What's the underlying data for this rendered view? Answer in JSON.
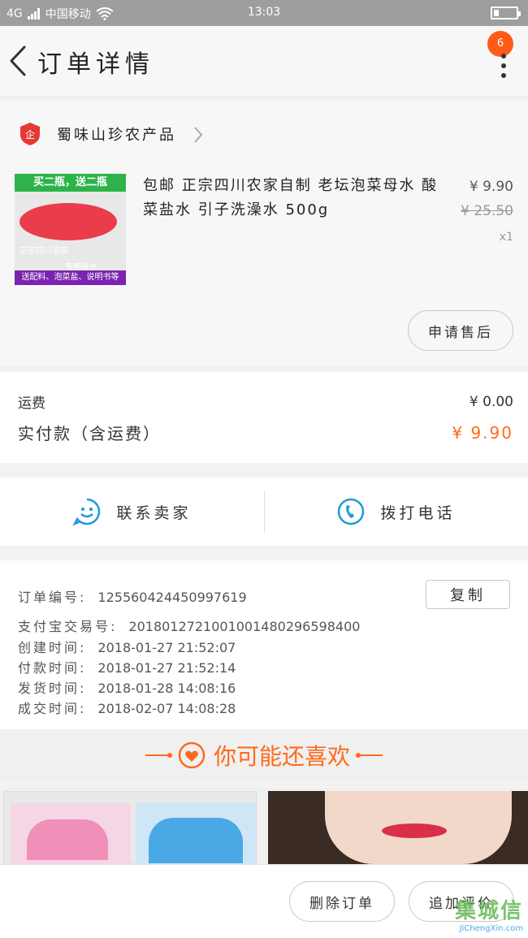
{
  "status_bar": {
    "signal": "4G",
    "carrier": "中国移动",
    "time": "13:03"
  },
  "header": {
    "title": "订单详情",
    "badge": "6"
  },
  "shop": {
    "name": "蜀味山珍农产品"
  },
  "item": {
    "image_top_text": "买二瓶，送二瓶",
    "image_caption": "正宗四川泡菜",
    "image_caption2": "专用母水",
    "image_bottom_text": "送配料、泡菜盐、说明书等",
    "title": "包邮 正宗四川农家自制 老坛泡菜母水 酸菜盐水 引子洗澡水 500g",
    "price": "¥ 9.90",
    "original_price": "¥ 25.50",
    "quantity": "x1",
    "after_sale_label": "申请售后"
  },
  "costs": {
    "shipping_label": "运费",
    "shipping_value": "¥ 0.00",
    "paid_label": "实付款（含运费）",
    "paid_value": "¥ 9.90"
  },
  "contact": {
    "seller_label": "联系卖家",
    "phone_label": "拨打电话"
  },
  "order_info": {
    "copy_label": "复制",
    "order_no_label": "订单编号:",
    "order_no": "125560424450997619",
    "alipay_label": "支付宝交易号:",
    "alipay_no": "2018012721001001480296598400",
    "created_label": "创建时间:",
    "created": "2018-01-27  21:52:07",
    "paid_label": "付款时间:",
    "paid": "2018-01-27  21:52:14",
    "shipped_label": "发货时间:",
    "shipped": "2018-01-28  14:08:16",
    "done_label": "成交时间:",
    "done": "2018-02-07  14:08:28"
  },
  "recommend": {
    "title": "你可能还喜欢"
  },
  "footer": {
    "delete_label": "删除订单",
    "review_label": "追加评价"
  },
  "watermark": {
    "text": "集城信",
    "sub": "JiChengXin.com"
  },
  "colors": {
    "accent": "#ff6a1a",
    "badge": "#ff5a17",
    "contact_icon": "#1e9bd7"
  }
}
